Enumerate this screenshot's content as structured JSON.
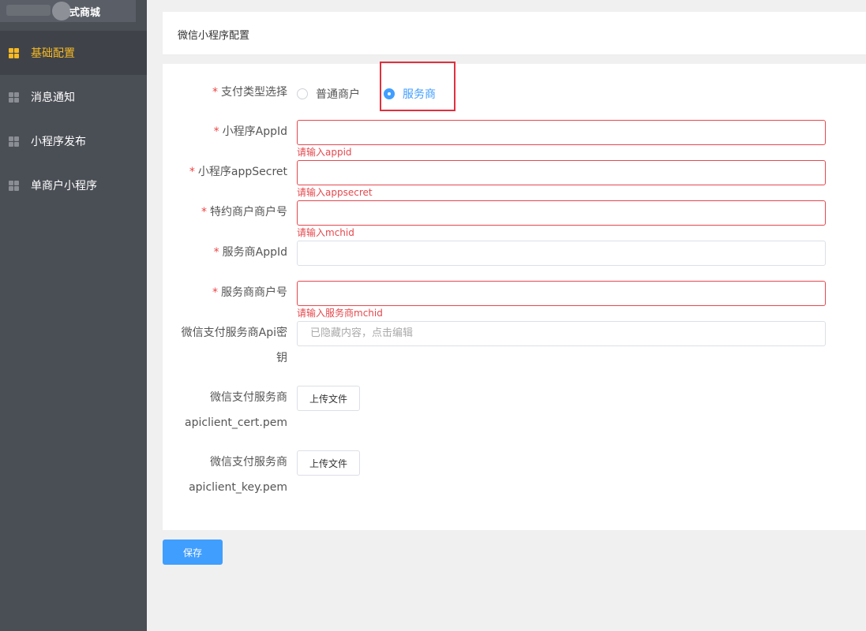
{
  "sidebar": {
    "brand": "式商城",
    "items": [
      {
        "label": "基础配置",
        "active": true
      },
      {
        "label": "消息通知",
        "active": false
      },
      {
        "label": "小程序发布",
        "active": false
      },
      {
        "label": "单商户小程序",
        "active": false
      }
    ]
  },
  "header": {
    "title": "微信小程序配置"
  },
  "form": {
    "pay_type": {
      "label": "支付类型选择",
      "options": [
        "普通商户",
        "服务商"
      ],
      "selected": "服务商"
    },
    "appid": {
      "label": "小程序AppId",
      "value": "",
      "error": "请输入appid"
    },
    "appsecret": {
      "label": "小程序appSecret",
      "value": "",
      "error": "请输入appsecret"
    },
    "mchid": {
      "label": "特约商户商户号",
      "value": "",
      "error": "请输入mchid"
    },
    "sp_appid": {
      "label": "服务商AppId",
      "value": ""
    },
    "sp_mchid": {
      "label": "服务商商户号",
      "value": "",
      "error": "请输入服务商mchid"
    },
    "api_key": {
      "label_line1": "微信支付服务商Api密",
      "label_line2": "钥",
      "placeholder": "已隐藏内容，点击编辑"
    },
    "cert": {
      "label_line1": "微信支付服务商",
      "label_line2": "apiclient_cert.pem",
      "button": "上传文件"
    },
    "key": {
      "label_line1": "微信支付服务商",
      "label_line2": "apiclient_key.pem",
      "button": "上传文件"
    }
  },
  "actions": {
    "save": "保存"
  },
  "colors": {
    "accent": "#409eff",
    "error": "#e5484d",
    "sidebar": "#4a4e55",
    "active_nav": "#f7b924",
    "highlight": "#e0303e"
  }
}
